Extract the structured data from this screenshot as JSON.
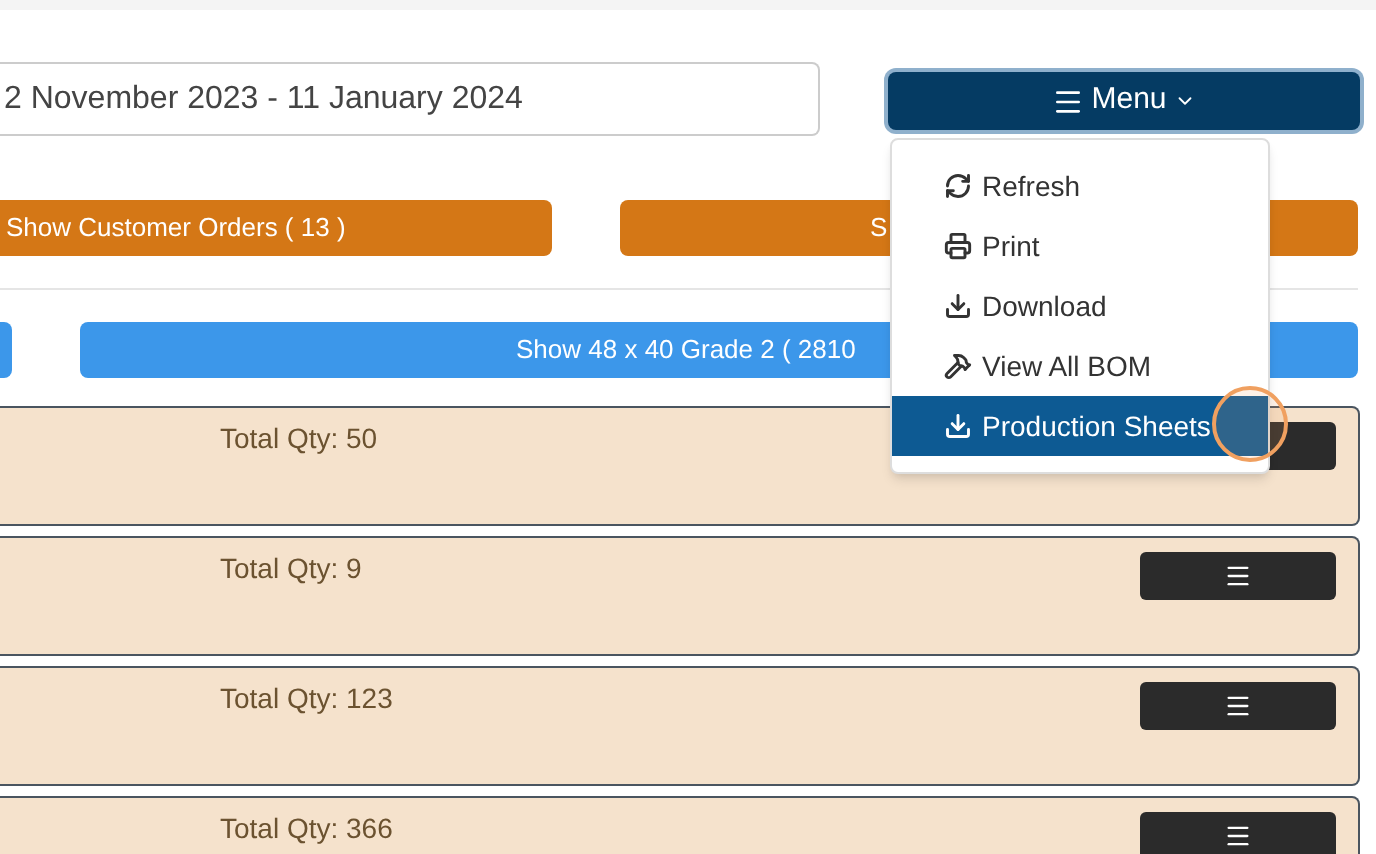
{
  "date_range": {
    "value": "2 November 2023 - 11 January 2024"
  },
  "menu": {
    "label": "Menu",
    "expanded": true,
    "items": [
      {
        "label": "Refresh",
        "kind": "refresh",
        "selected": false
      },
      {
        "label": "Print",
        "kind": "print",
        "selected": false
      },
      {
        "label": "Download",
        "kind": "download",
        "selected": false
      },
      {
        "label": "View All BOM",
        "kind": "hammer",
        "selected": false
      },
      {
        "label": "Production Sheets",
        "kind": "download",
        "selected": true
      }
    ]
  },
  "filter_buttons": [
    {
      "label": "Show Customer Orders ( 13 )"
    },
    {
      "label": "S"
    }
  ],
  "grade_button": {
    "label": "Show 48 x 40 Grade 2 ( 2810"
  },
  "orders": [
    {
      "total_qty": "Total Qty: 50"
    },
    {
      "total_qty": "Total Qty: 9"
    },
    {
      "total_qty": "Total Qty: 123"
    },
    {
      "total_qty": "Total Qty: 366"
    }
  ]
}
